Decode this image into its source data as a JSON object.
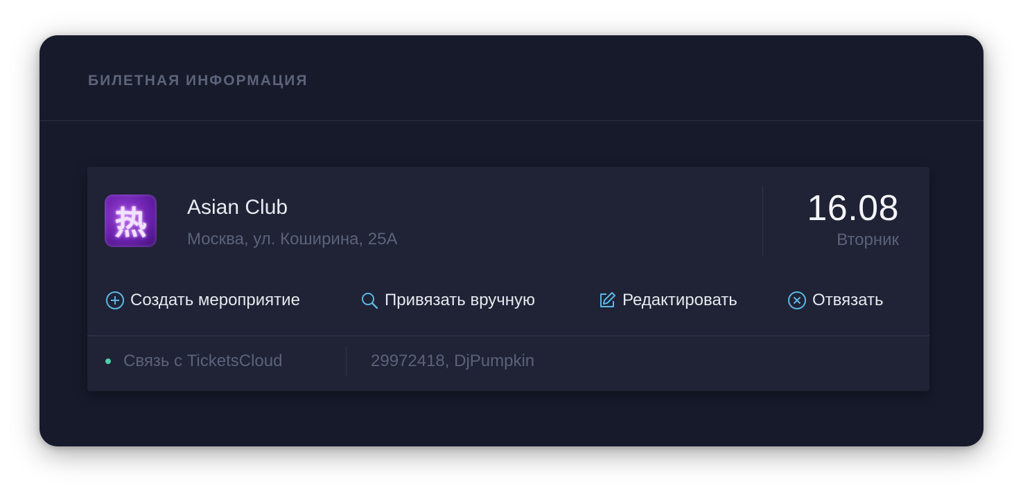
{
  "panel": {
    "title": "БИЛЕТНАЯ ИНФОРМАЦИЯ"
  },
  "event": {
    "logo_glyph": "热",
    "name": "Asian Club",
    "address": "Москва, ул. Коширина, 25А",
    "date": "16.08",
    "weekday": "Вторник"
  },
  "actions": [
    {
      "label": "Создать мероприятие",
      "icon": "plus-circle-icon"
    },
    {
      "label": "Привязать вручную",
      "icon": "search-icon"
    },
    {
      "label": "Редактировать",
      "icon": "edit-icon"
    },
    {
      "label": "Отвязать",
      "icon": "close-circle-icon"
    }
  ],
  "footer": {
    "status_label": "Связь с TicketsCloud",
    "status_value": "29972418, DjPumpkin"
  },
  "colors": {
    "panel_bg": "#161a2b",
    "card_bg": "#1f2335",
    "icon_accent": "#5cb8e6",
    "status_dot": "#4ed1a6",
    "muted_text": "#5b627a"
  }
}
